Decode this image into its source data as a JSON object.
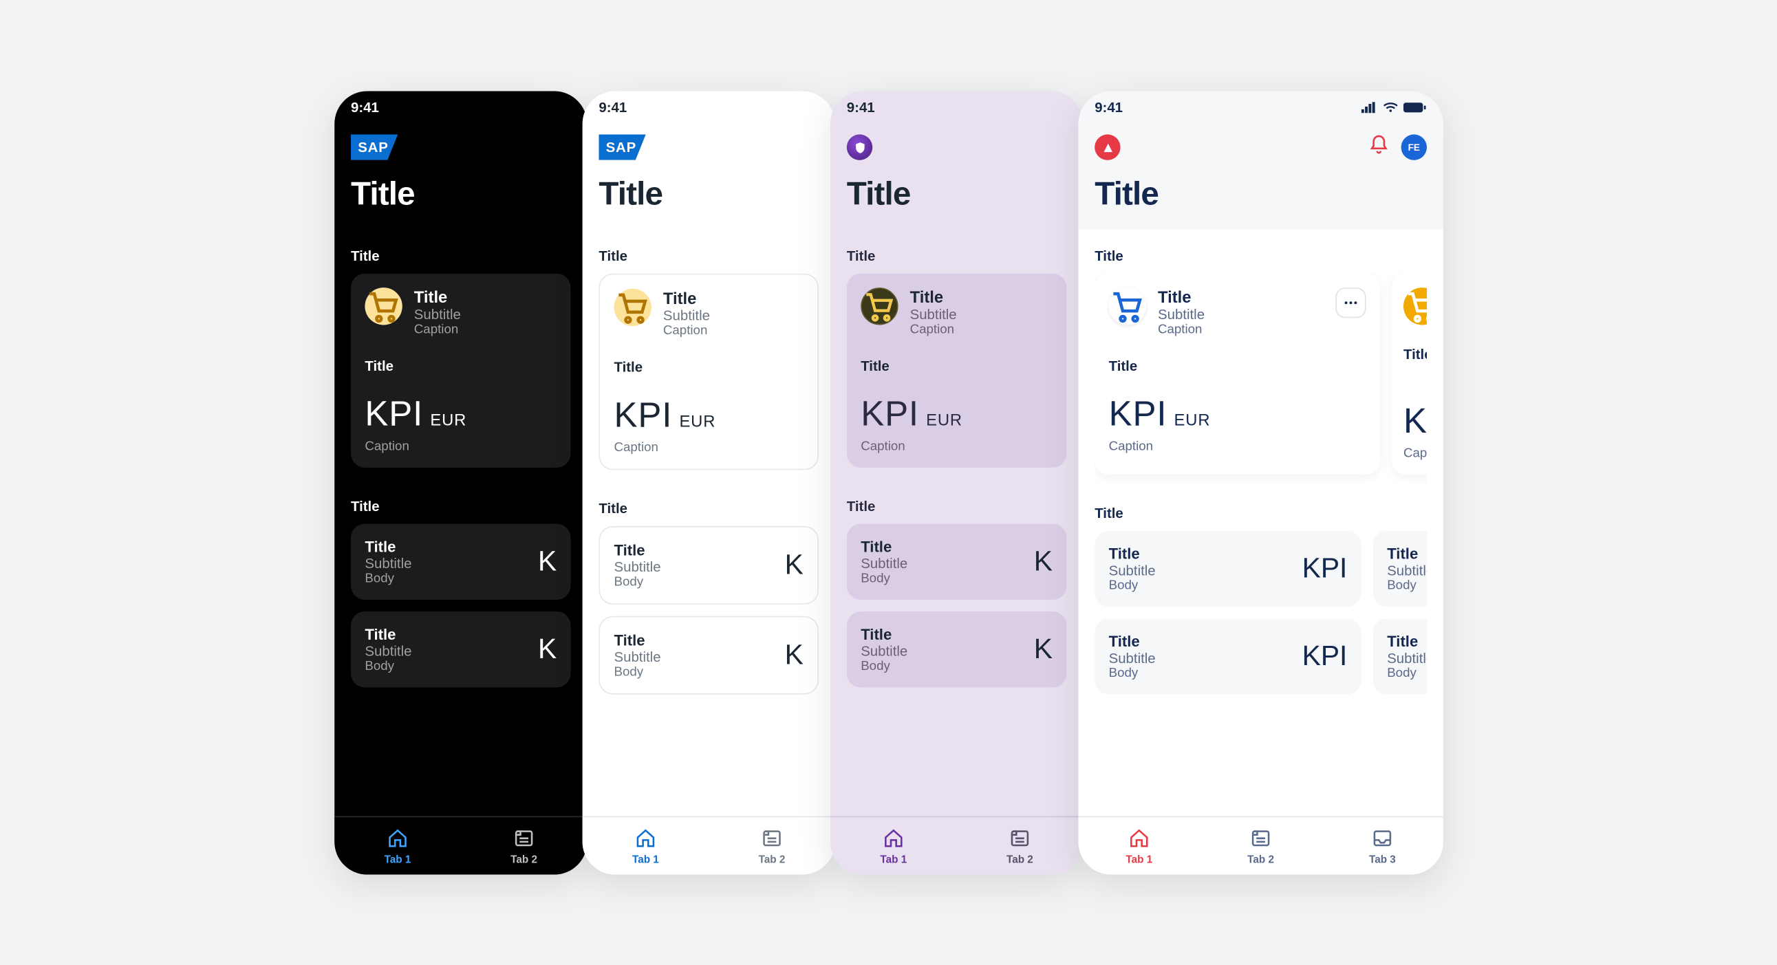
{
  "common": {
    "time": "9:41",
    "page_title": "Title",
    "section_title_1": "Title",
    "section_title_2": "Title",
    "card": {
      "title": "Title",
      "subtitle": "Subtitle",
      "caption": "Caption",
      "kpi_label": "Title",
      "kpi_value": "KPI",
      "kpi_unit": "EUR",
      "kpi_caption": "Caption"
    },
    "list_item": {
      "title": "Title",
      "subtitle": "Subtitle",
      "body": "Body",
      "kpi": "KPI",
      "kpi_trunc": "K"
    },
    "tabs": {
      "tab1": "Tab 1",
      "tab2": "Tab 2",
      "tab3": "Tab 3"
    }
  },
  "screens": [
    {
      "theme": "dark",
      "logo": "sap",
      "status_icons": false,
      "header_actions": false,
      "tab_count": 2,
      "card_icon_style": "yellow-light",
      "card_more": false,
      "overflow_cards": false
    },
    {
      "theme": "light",
      "logo": "sap",
      "status_icons": false,
      "header_actions": false,
      "tab_count": 2,
      "card_icon_style": "yellow-light",
      "card_more": false,
      "overflow_cards": false
    },
    {
      "theme": "lilac",
      "logo": "purple",
      "status_icons": false,
      "header_actions": false,
      "tab_count": 2,
      "card_icon_style": "yellow-dark",
      "card_more": false,
      "overflow_cards": false
    },
    {
      "theme": "red",
      "logo": "red",
      "status_icons": true,
      "header_actions": true,
      "tab_count": 3,
      "card_icon_style": "white-blue",
      "card_more": true,
      "overflow_cards": true,
      "avatar_initials": "FE"
    }
  ]
}
